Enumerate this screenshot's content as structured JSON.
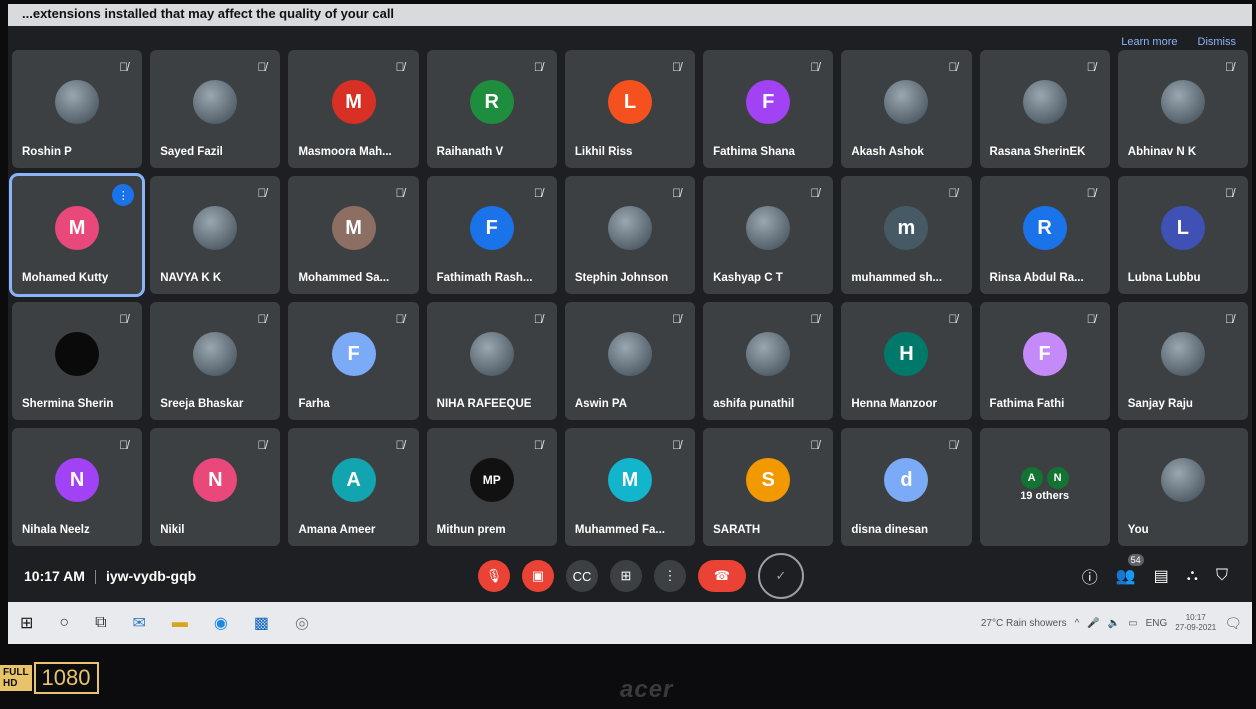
{
  "banner": {
    "text": "...extensions installed that may affect the quality of your call",
    "learn_more": "Learn more",
    "dismiss": "Dismiss"
  },
  "participants": [
    {
      "name": "Roshin P",
      "initial": "",
      "color": "",
      "photo": true
    },
    {
      "name": "Sayed Fazil",
      "initial": "",
      "color": "",
      "photo": true
    },
    {
      "name": "Masmoora Mah...",
      "initial": "M",
      "color": "#d93025"
    },
    {
      "name": "Raihanath V",
      "initial": "R",
      "color": "#1e8e3e"
    },
    {
      "name": "Likhil Riss",
      "initial": "L",
      "color": "#f4511e"
    },
    {
      "name": "Fathima Shana",
      "initial": "F",
      "color": "#a142f4"
    },
    {
      "name": "Akash Ashok",
      "initial": "",
      "color": "",
      "photo": true
    },
    {
      "name": "Rasana SherinEK",
      "initial": "",
      "color": "",
      "photo": true
    },
    {
      "name": "Abhinav N K",
      "initial": "",
      "color": "",
      "photo": true
    },
    {
      "name": "Mohamed Kutty",
      "initial": "M",
      "color": "#e8497a",
      "active": true
    },
    {
      "name": "NAVYA K K",
      "initial": "",
      "color": "",
      "photo": true
    },
    {
      "name": "Mohammed Sa...",
      "initial": "M",
      "color": "#8d6e63"
    },
    {
      "name": "Fathimath Rash...",
      "initial": "F",
      "color": "#1a73e8"
    },
    {
      "name": "Stephin Johnson",
      "initial": "",
      "color": "",
      "photo": true
    },
    {
      "name": "Kashyap C T",
      "initial": "",
      "color": "",
      "photo": true
    },
    {
      "name": "muhammed sh...",
      "initial": "m",
      "color": "#455a64"
    },
    {
      "name": "Rinsa Abdul Ra...",
      "initial": "R",
      "color": "#1a73e8"
    },
    {
      "name": "Lubna Lubbu",
      "initial": "L",
      "color": "#3f51b5"
    },
    {
      "name": "Shermina Sherin",
      "initial": "",
      "color": "",
      "dark": true
    },
    {
      "name": "Sreeja Bhaskar",
      "initial": "",
      "color": "",
      "photo": true
    },
    {
      "name": "Farha",
      "initial": "F",
      "color": "#7baaf7"
    },
    {
      "name": "NIHA RAFEEQUE",
      "initial": "",
      "color": "",
      "photo": true
    },
    {
      "name": "Aswin PA",
      "initial": "",
      "color": "",
      "photo": true
    },
    {
      "name": "ashifa punathil",
      "initial": "",
      "color": "",
      "photo": true
    },
    {
      "name": "Henna Manzoor",
      "initial": "H",
      "color": "#00796b"
    },
    {
      "name": "Fathima Fathi",
      "initial": "F",
      "color": "#c58af9"
    },
    {
      "name": "Sanjay Raju",
      "initial": "",
      "color": "",
      "photo": true
    },
    {
      "name": "Nihala Neelz",
      "initial": "N",
      "color": "#a142f4"
    },
    {
      "name": "Nikil",
      "initial": "N",
      "color": "#e8497a"
    },
    {
      "name": "Amana Ameer",
      "initial": "A",
      "color": "#12a4af"
    },
    {
      "name": "Mithun prem",
      "initial": "MP",
      "color": "#111111"
    },
    {
      "name": "Muhammed Fa...",
      "initial": "M",
      "color": "#12b5cb"
    },
    {
      "name": "SARATH",
      "initial": "S",
      "color": "#f29900"
    },
    {
      "name": "disna dinesan",
      "initial": "d",
      "color": "#7baaf7"
    },
    {
      "name": "19 others",
      "others": true,
      "initials": [
        "A",
        "N"
      ]
    },
    {
      "name": "You",
      "initial": "",
      "color": "",
      "photo": true,
      "self": true
    }
  ],
  "meeting": {
    "time": "10:17 AM",
    "code": "iyw-vydb-gqb",
    "people_count": "54"
  },
  "taskbar": {
    "weather": "27°C Rain showers",
    "lang": "ENG",
    "clock_time": "10:17",
    "clock_date": "27-09-2021"
  },
  "bezel": {
    "hd_top": "FULL",
    "hd_bottom": "HD",
    "resolution": "1080",
    "brand": "acer"
  }
}
